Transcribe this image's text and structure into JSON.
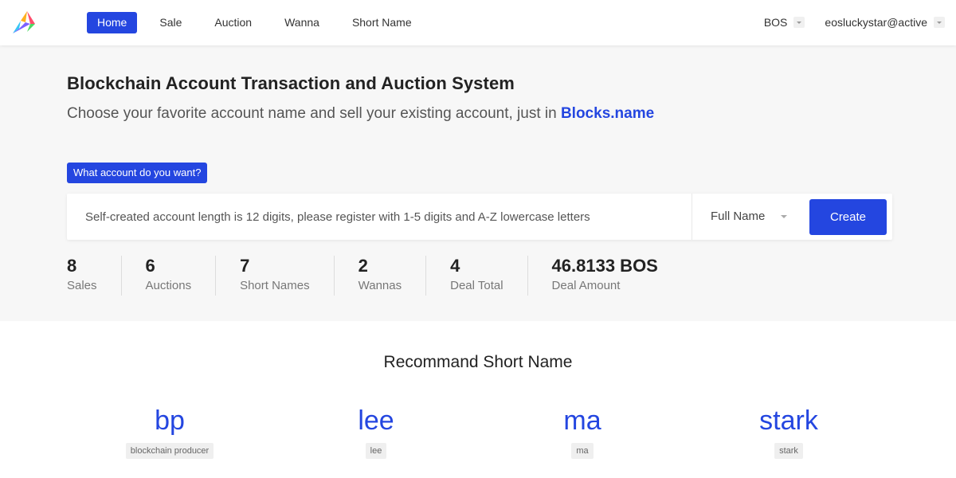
{
  "header": {
    "nav": [
      "Home",
      "Sale",
      "Auction",
      "Wanna",
      "Short Name"
    ],
    "chain": "BOS",
    "account": "eosluckystar@active"
  },
  "hero": {
    "title": "Blockchain Account Transaction and Auction System",
    "subtitle_prefix": "Choose your favorite account name and sell your existing account, just in ",
    "brand": "Blocks.name",
    "ask_tag": "What account do you want?",
    "search_placeholder": "Self-created account length is 12 digits, please register with 1-5 digits and A-Z lowercase letters",
    "type_select": "Full Name",
    "create_label": "Create"
  },
  "stats": [
    {
      "value": "8",
      "label": "Sales"
    },
    {
      "value": "6",
      "label": "Auctions"
    },
    {
      "value": "7",
      "label": "Short Names"
    },
    {
      "value": "2",
      "label": "Wannas"
    },
    {
      "value": "4",
      "label": "Deal Total"
    },
    {
      "value": "46.8133 BOS",
      "label": "Deal Amount"
    }
  ],
  "recommend": {
    "title": "Recommand Short Name",
    "items": [
      {
        "name": "bp",
        "desc": "blockchain producer"
      },
      {
        "name": "lee",
        "desc": "lee"
      },
      {
        "name": "ma",
        "desc": "ma"
      },
      {
        "name": "stark",
        "desc": "stark"
      }
    ]
  },
  "colors": {
    "accent": "#2446e0",
    "hero_bg": "#f7f7f7"
  }
}
